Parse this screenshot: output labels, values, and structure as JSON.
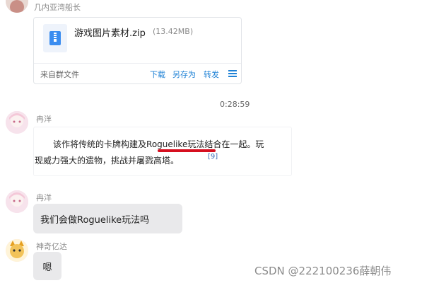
{
  "messages": {
    "m1": {
      "sender": "几内亚湾船长",
      "file": {
        "name": "游戏图片素材.zip",
        "size": "(13.42MB)",
        "source": "来自群文件",
        "actions": {
          "download": "下载",
          "save_as": "另存为",
          "forward": "转发"
        }
      }
    },
    "timestamp": "0:28:59",
    "m2": {
      "sender": "冉洋",
      "line1_prefix": "该作将传统的卡牌构建及",
      "line1_highlight": "Roguelike",
      "line1_suffix": "玩法结合在一起。玩",
      "line2": "现威力强大的遗物，挑战并屠戮高塔。",
      "ref": "[9]"
    },
    "m3": {
      "sender": "冉洋",
      "text": "我们会做Roguelike玩法吗"
    },
    "m4": {
      "sender": "神奇亿达",
      "text": "嗯"
    }
  },
  "watermark": "CSDN @222100236薛朝伟",
  "colors": {
    "link": "#1f82d6",
    "bubble": "#e9e9eb",
    "underline": "#d60f1f"
  }
}
